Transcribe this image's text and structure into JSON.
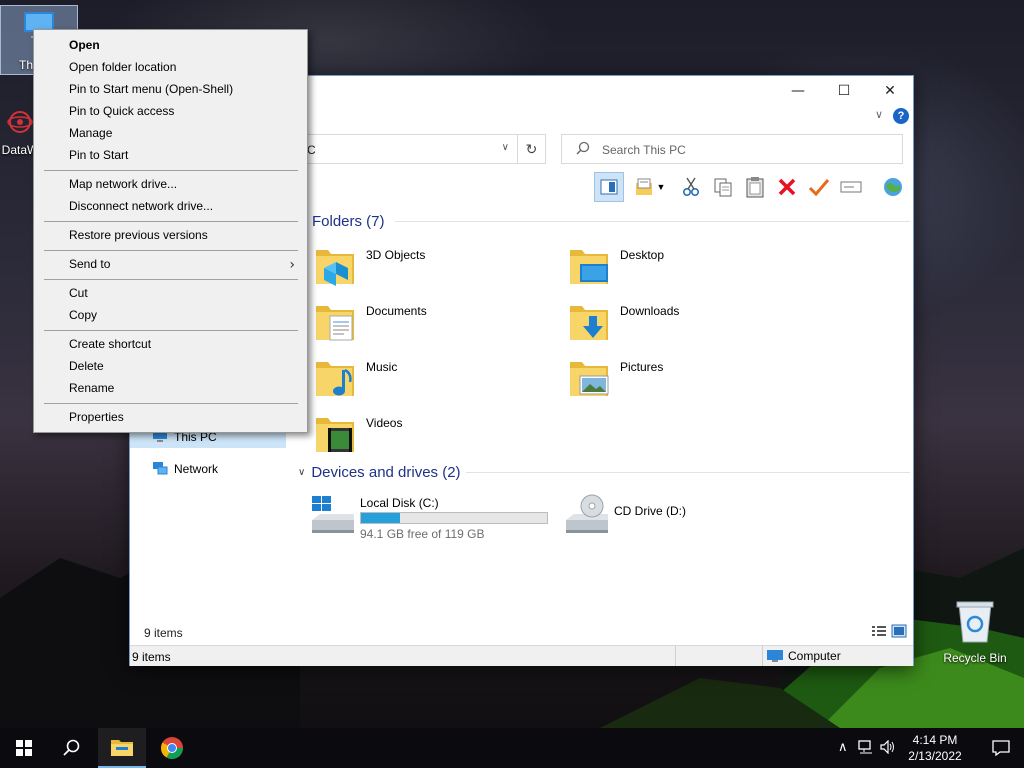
{
  "desktop": {
    "icons": [
      {
        "label": "Th"
      },
      {
        "label": "DataW"
      },
      {
        "label": "Recycle Bin"
      }
    ]
  },
  "explorer": {
    "address_text": "C",
    "search_placeholder": "Search This PC",
    "nav": {
      "this_pc": "This PC",
      "network": "Network"
    },
    "groups": {
      "folders_header": "Folders (7)",
      "devices_header": "Devices and drives (2)"
    },
    "folders": [
      {
        "name": "3D Objects",
        "icon": "3d-objects-folder-icon"
      },
      {
        "name": "Desktop",
        "icon": "desktop-folder-icon"
      },
      {
        "name": "Documents",
        "icon": "documents-folder-icon"
      },
      {
        "name": "Downloads",
        "icon": "downloads-folder-icon"
      },
      {
        "name": "Music",
        "icon": "music-folder-icon"
      },
      {
        "name": "Pictures",
        "icon": "pictures-folder-icon"
      },
      {
        "name": "Videos",
        "icon": "videos-folder-icon"
      }
    ],
    "drives": [
      {
        "name": "Local Disk (C:)",
        "free_text": "94.1 GB free of 119 GB",
        "used_fraction": 0.21
      },
      {
        "name": "CD Drive (D:)"
      }
    ],
    "items_count": "9 items",
    "status": {
      "items": "9 items",
      "location": "Computer"
    }
  },
  "context_menu": {
    "items": [
      {
        "label": "Open"
      },
      {
        "label": "Open folder location"
      },
      {
        "label": "Pin to Start menu (Open-Shell)"
      },
      {
        "label": "Pin to Quick access"
      },
      {
        "label": "Manage"
      },
      {
        "label": "Pin to Start"
      },
      {
        "label": "Map network drive..."
      },
      {
        "label": "Disconnect network drive..."
      },
      {
        "label": "Restore previous versions"
      },
      {
        "label": "Send to"
      },
      {
        "label": "Cut"
      },
      {
        "label": "Copy"
      },
      {
        "label": "Create shortcut"
      },
      {
        "label": "Delete"
      },
      {
        "label": "Rename"
      },
      {
        "label": "Properties"
      }
    ]
  },
  "taskbar": {
    "time": "4:14 PM",
    "date": "2/13/2022"
  },
  "colors": {
    "accent": "#1e3287",
    "selection": "#cce4f7",
    "drive_bar": "#26a0da",
    "delete_red": "#e81123",
    "check_orange": "#e86a1c"
  }
}
